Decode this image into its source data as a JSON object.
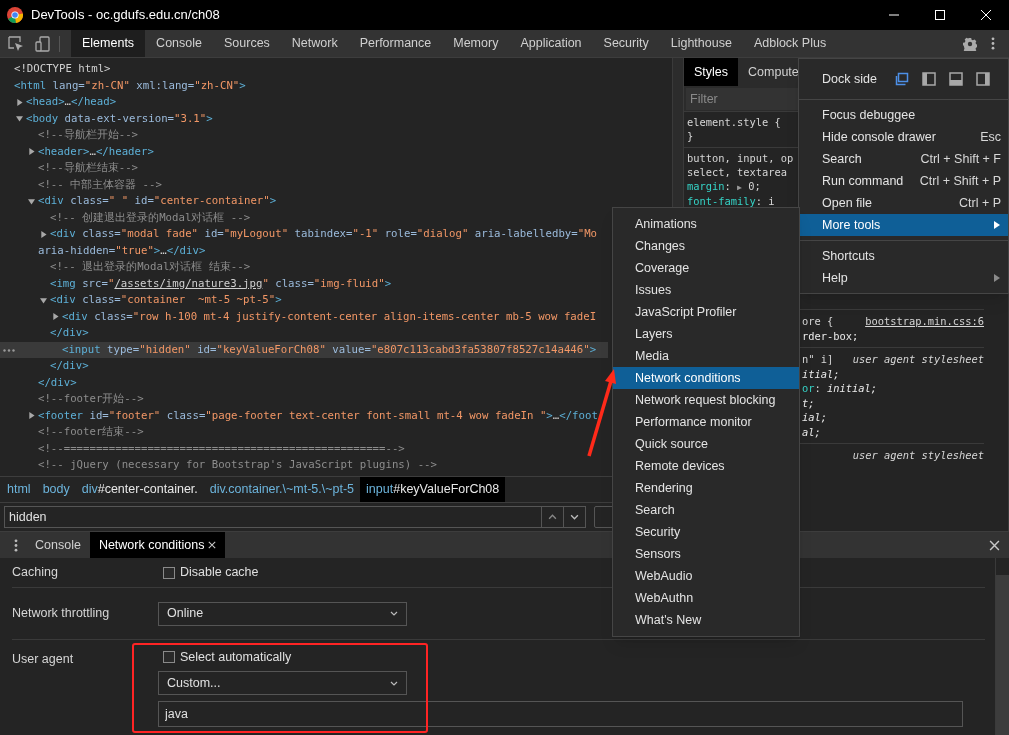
{
  "window": {
    "title": "DevTools - oc.gdufs.edu.cn/ch08"
  },
  "toolbar": {
    "tabs": [
      {
        "label": "Elements",
        "selected": true
      },
      {
        "label": "Console",
        "selected": false
      },
      {
        "label": "Sources",
        "selected": false
      },
      {
        "label": "Network",
        "selected": false
      },
      {
        "label": "Performance",
        "selected": false
      },
      {
        "label": "Memory",
        "selected": false
      },
      {
        "label": "Application",
        "selected": false
      },
      {
        "label": "Security",
        "selected": false
      },
      {
        "label": "Lighthouse",
        "selected": false
      },
      {
        "label": "Adblock Plus",
        "selected": false
      }
    ]
  },
  "dom_tree": [
    {
      "kind": "node",
      "selected": false,
      "lines": [
        [
          {
            "kind": "text",
            "text": "<!DOCTYPE html>"
          }
        ]
      ]
    },
    {
      "kind": "node",
      "selected": false,
      "lines": [
        [
          {
            "kind": "tag",
            "text": "<html"
          },
          {
            "kind": "attr",
            "text": " lang="
          },
          {
            "kind": "val",
            "text": "\"zh-CN\""
          },
          {
            "kind": "attr",
            "text": " xml:lang="
          },
          {
            "kind": "val",
            "text": "\"zh-CN\""
          },
          {
            "kind": "tag",
            "text": ">"
          }
        ]
      ],
      "children": [
        {
          "kind": "node",
          "expanded": false,
          "selected": false,
          "lines": [
            [
              {
                "kind": "tag",
                "text": "<head>"
              },
              {
                "kind": "text",
                "text": "…"
              },
              {
                "kind": "tag",
                "text": "</head>"
              }
            ]
          ]
        },
        {
          "kind": "node",
          "expanded": true,
          "selected": false,
          "lines": [
            [
              {
                "kind": "tag",
                "text": "<body"
              },
              {
                "kind": "attr",
                "text": " data-ext-version="
              },
              {
                "kind": "val",
                "text": "\"3.1\""
              },
              {
                "kind": "tag",
                "text": ">"
              }
            ]
          ],
          "children": [
            {
              "kind": "node",
              "selected": false,
              "lines": [
                [
                  {
                    "kind": "cmt",
                    "text": "<!--导航栏开始-->"
                  }
                ]
              ]
            },
            {
              "kind": "node",
              "expanded": false,
              "selected": false,
              "lines": [
                [
                  {
                    "kind": "tag",
                    "text": "<header>"
                  },
                  {
                    "kind": "text",
                    "text": "…"
                  },
                  {
                    "kind": "tag",
                    "text": "</header>"
                  }
                ]
              ]
            },
            {
              "kind": "node",
              "selected": false,
              "lines": [
                [
                  {
                    "kind": "cmt",
                    "text": "<!--导航栏结束-->"
                  }
                ]
              ]
            },
            {
              "kind": "node",
              "selected": false,
              "lines": [
                [
                  {
                    "kind": "cmt",
                    "text": "<!-- 中部主体容器 -->"
                  }
                ]
              ]
            },
            {
              "kind": "node",
              "expanded": true,
              "selected": false,
              "lines": [
                [
                  {
                    "kind": "tag",
                    "text": "<div"
                  },
                  {
                    "kind": "attr",
                    "text": " class="
                  },
                  {
                    "kind": "val",
                    "text": "\" \""
                  },
                  {
                    "kind": "attr",
                    "text": " id="
                  },
                  {
                    "kind": "val",
                    "text": "\"center-container\""
                  },
                  {
                    "kind": "tag",
                    "text": ">"
                  }
                ]
              ],
              "children": [
                {
                  "kind": "node",
                  "selected": false,
                  "lines": [
                    [
                      {
                        "kind": "cmt",
                        "text": "<!-- 创建退出登录的Modal对话框 -->"
                      }
                    ]
                  ]
                },
                {
                  "kind": "node",
                  "expanded": false,
                  "selected": false,
                  "lines": [
                    [
                      {
                        "kind": "tag",
                        "text": "<div"
                      },
                      {
                        "kind": "attr",
                        "text": " class="
                      },
                      {
                        "kind": "val",
                        "text": "\"modal fade\""
                      },
                      {
                        "kind": "attr",
                        "text": " id="
                      },
                      {
                        "kind": "val",
                        "text": "\"myLogout\""
                      },
                      {
                        "kind": "attr",
                        "text": " tabindex="
                      },
                      {
                        "kind": "val",
                        "text": "\"-1\""
                      },
                      {
                        "kind": "attr",
                        "text": " role="
                      },
                      {
                        "kind": "val",
                        "text": "\"dialog\""
                      },
                      {
                        "kind": "attr",
                        "text": " aria-labelledby="
                      },
                      {
                        "kind": "val",
                        "text": "\"Mo"
                      }
                    ],
                    [
                      {
                        "kind": "attr",
                        "text": "aria-hidden="
                      },
                      {
                        "kind": "val",
                        "text": "\"true\""
                      },
                      {
                        "kind": "tag",
                        "text": ">"
                      },
                      {
                        "kind": "text",
                        "text": "…"
                      },
                      {
                        "kind": "tag",
                        "text": "</div>"
                      }
                    ]
                  ]
                },
                {
                  "kind": "node",
                  "selected": false,
                  "lines": [
                    [
                      {
                        "kind": "cmt",
                        "text": "<!-- 退出登录的Modal对话框 结束-->"
                      }
                    ]
                  ]
                },
                {
                  "kind": "node",
                  "selected": false,
                  "lines": [
                    [
                      {
                        "kind": "tag",
                        "text": "<img"
                      },
                      {
                        "kind": "attr",
                        "text": " src="
                      },
                      {
                        "kind": "val",
                        "text": "\""
                      },
                      {
                        "kind": "link",
                        "text": "/assets/img/nature3.jpg"
                      },
                      {
                        "kind": "val",
                        "text": "\""
                      },
                      {
                        "kind": "attr",
                        "text": " class="
                      },
                      {
                        "kind": "val",
                        "text": "\"img-fluid\""
                      },
                      {
                        "kind": "tag",
                        "text": ">"
                      }
                    ]
                  ]
                },
                {
                  "kind": "node",
                  "expanded": true,
                  "selected": false,
                  "lines": [
                    [
                      {
                        "kind": "tag",
                        "text": "<div"
                      },
                      {
                        "kind": "attr",
                        "text": " class="
                      },
                      {
                        "kind": "val",
                        "text": "\"container  ~mt-5 ~pt-5\""
                      },
                      {
                        "kind": "tag",
                        "text": ">"
                      }
                    ]
                  ],
                  "children": [
                    {
                      "kind": "node",
                      "expanded": false,
                      "selected": false,
                      "lines": [
                        [
                          {
                            "kind": "tag",
                            "text": "<div"
                          },
                          {
                            "kind": "attr",
                            "text": " class="
                          },
                          {
                            "kind": "val",
                            "text": "\"row h-100 mt-4 justify-content-center align-items-center mb-5 wow fadeI"
                          }
                        ]
                      ]
                    },
                    {
                      "kind": "close",
                      "selected": false,
                      "lines": [
                        [
                          {
                            "kind": "tag",
                            "text": "</div>"
                          }
                        ]
                      ]
                    },
                    {
                      "kind": "node",
                      "selected": true,
                      "lines": [
                        [
                          {
                            "kind": "tag",
                            "text": "<input"
                          },
                          {
                            "kind": "attr",
                            "text": " type="
                          },
                          {
                            "kind": "val",
                            "text": "\"hidden\""
                          },
                          {
                            "kind": "attr",
                            "text": " id="
                          },
                          {
                            "kind": "val",
                            "text": "\"keyValueForCh08\""
                          },
                          {
                            "kind": "attr",
                            "text": " value="
                          },
                          {
                            "kind": "val",
                            "text": "\"e807c113cabd3fa53807f8527c14a446\""
                          },
                          {
                            "kind": "tag",
                            "text": ">"
                          }
                        ]
                      ]
                    },
                    {
                      "kind": "close",
                      "selected": false,
                      "lines": [
                        [
                          {
                            "kind": "tag",
                            "text": "</div>"
                          }
                        ]
                      ]
                    }
                  ]
                },
                {
                  "kind": "close",
                  "selected": false,
                  "lines": [
                    [
                      {
                        "kind": "tag",
                        "text": "</div>"
                      }
                    ]
                  ]
                }
              ]
            },
            {
              "kind": "node",
              "selected": false,
              "lines": [
                [
                  {
                    "kind": "cmt",
                    "text": "<!--footer开始-->"
                  }
                ]
              ]
            },
            {
              "kind": "node",
              "expanded": false,
              "selected": false,
              "lines": [
                [
                  {
                    "kind": "tag",
                    "text": "<footer"
                  },
                  {
                    "kind": "attr",
                    "text": " id="
                  },
                  {
                    "kind": "val",
                    "text": "\"footer\""
                  },
                  {
                    "kind": "attr",
                    "text": " class="
                  },
                  {
                    "kind": "val",
                    "text": "\"page-footer text-center font-small mt-4 wow fadeIn \""
                  },
                  {
                    "kind": "tag",
                    "text": ">"
                  },
                  {
                    "kind": "text",
                    "text": "…"
                  },
                  {
                    "kind": "tag",
                    "text": "</foot"
                  }
                ]
              ]
            },
            {
              "kind": "node",
              "selected": false,
              "lines": [
                [
                  {
                    "kind": "cmt",
                    "text": "<!--footer结束-->"
                  }
                ]
              ]
            },
            {
              "kind": "node",
              "selected": false,
              "lines": [
                [
                  {
                    "kind": "cmt",
                    "text": "<!--==================================================-->"
                  }
                ]
              ]
            },
            {
              "kind": "node",
              "selected": false,
              "lines": [
                [
                  {
                    "kind": "cmt",
                    "text": "<!-- jQuery (necessary for Bootstrap's JavaScript plugins) -->"
                  }
                ]
              ]
            }
          ]
        }
      ]
    }
  ],
  "styles_panel": {
    "tabs": [
      {
        "label": "Styles",
        "selected": true
      },
      {
        "label": "Compute",
        "selected": false
      }
    ],
    "filter": {
      "placeholder": "Filter"
    },
    "rules": [
      {
        "kind": "full",
        "lines": [
          [
            {
              "kind": "sel",
              "text": "element.style {"
            }
          ],
          [
            {
              "kind": "sel",
              "text": "}"
            }
          ]
        ]
      },
      {
        "kind": "full",
        "lines": [
          [
            {
              "kind": "sel",
              "text": "button, input, op"
            }
          ],
          [
            {
              "kind": "sel",
              "text": "select, textarea"
            }
          ],
          [
            {
              "kind": "prop",
              "text": "margin"
            },
            {
              "kind": "sel",
              "text": ": "
            },
            {
              "kind": "mark",
              "text": "▶"
            },
            {
              "kind": "sel",
              "text": " 0;"
            }
          ],
          [
            {
              "kind": "prop",
              "text": "font-family"
            },
            {
              "kind": "sel",
              "text": ": i"
            }
          ]
        ]
      },
      {
        "kind": "clipped",
        "source": "bootstrap.min.css:6",
        "lines": [
          [
            {
              "kind": "sel",
              "text": "ore {"
            }
          ],
          [
            {
              "kind": "val",
              "text": "rder-box;"
            }
          ]
        ]
      },
      {
        "kind": "clipped",
        "origin": "user agent stylesheet",
        "lines": [
          [
            {
              "kind": "sel",
              "text": "n\" i]"
            }
          ],
          [
            {
              "kind": "ua",
              "text": "itial;"
            }
          ],
          [
            {
              "kind": "prop",
              "text": "or"
            },
            {
              "kind": "sel",
              "text": ": "
            },
            {
              "kind": "ua",
              "text": "initial;"
            }
          ],
          [
            {
              "kind": "ua",
              "text": "t;"
            }
          ],
          [
            {
              "kind": "ua",
              "text": "ial;"
            }
          ],
          [
            {
              "kind": "ua",
              "text": "al;"
            }
          ]
        ]
      },
      {
        "kind": "clipped",
        "origin": "user agent stylesheet"
      }
    ]
  },
  "breadcrumbs": [
    {
      "tag": "html",
      "selected": false
    },
    {
      "tag": "body",
      "selected": false
    },
    {
      "tag": "div",
      "rest": "#center-container.",
      "selected": false
    },
    {
      "tag": "div.container.\\~mt-5.\\~pt-5",
      "selected": false
    },
    {
      "tag": "input",
      "rest": "#keyValueForCh08",
      "selected": true
    }
  ],
  "search": {
    "value": "hidden"
  },
  "drawer": {
    "tabs": [
      {
        "label": "Console",
        "selected": false,
        "closable": false
      },
      {
        "label": "Network conditions",
        "selected": true,
        "closable": true
      }
    ]
  },
  "network_conditions": {
    "caching": {
      "label": "Caching",
      "checkbox": {
        "label": "Disable cache",
        "checked": false
      }
    },
    "throttling": {
      "label": "Network throttling",
      "value": "Online"
    },
    "user_agent": {
      "label": "User agent",
      "checkbox": {
        "label": "Select automatically",
        "checked": false
      },
      "preset": "Custom...",
      "custom_value": "java"
    }
  },
  "main_menu": {
    "groups": [
      {
        "items": [
          {
            "kind": "dock",
            "label": "Dock side",
            "options": [
              {
                "selected": true
              },
              {
                "selected": false
              },
              {
                "selected": false
              },
              {
                "selected": false
              }
            ]
          }
        ]
      },
      {
        "items": [
          {
            "kind": "item",
            "label": "Focus debuggee",
            "selected": false,
            "has_submenu": false
          },
          {
            "kind": "item",
            "label": "Hide console drawer",
            "shortcut": "Esc",
            "selected": false,
            "has_submenu": false
          },
          {
            "kind": "item",
            "label": "Search",
            "shortcut": "Ctrl + Shift + F",
            "selected": false,
            "has_submenu": false
          },
          {
            "kind": "item",
            "label": "Run command",
            "shortcut": "Ctrl + Shift + P",
            "selected": false,
            "has_submenu": false
          },
          {
            "kind": "item",
            "label": "Open file",
            "shortcut": "Ctrl + P",
            "selected": false,
            "has_submenu": false
          },
          {
            "kind": "item",
            "label": "More tools",
            "selected": true,
            "has_submenu": true
          }
        ]
      },
      {
        "items": [
          {
            "kind": "item",
            "label": "Shortcuts",
            "selected": false,
            "has_submenu": false
          },
          {
            "kind": "item",
            "label": "Help",
            "selected": false,
            "has_submenu": true
          }
        ]
      }
    ]
  },
  "more_tools_menu": [
    {
      "label": "Animations",
      "selected": false
    },
    {
      "label": "Changes",
      "selected": false
    },
    {
      "label": "Coverage",
      "selected": false
    },
    {
      "label": "Issues",
      "selected": false
    },
    {
      "label": "JavaScript Profiler",
      "selected": false
    },
    {
      "label": "Layers",
      "selected": false
    },
    {
      "label": "Media",
      "selected": false
    },
    {
      "label": "Network conditions",
      "selected": true
    },
    {
      "label": "Network request blocking",
      "selected": false
    },
    {
      "label": "Performance monitor",
      "selected": false
    },
    {
      "label": "Quick source",
      "selected": false
    },
    {
      "label": "Remote devices",
      "selected": false
    },
    {
      "label": "Rendering",
      "selected": false
    },
    {
      "label": "Search",
      "selected": false
    },
    {
      "label": "Security",
      "selected": false
    },
    {
      "label": "Sensors",
      "selected": false
    },
    {
      "label": "WebAudio",
      "selected": false
    },
    {
      "label": "WebAuthn",
      "selected": false
    },
    {
      "label": "What's New",
      "selected": false
    }
  ]
}
